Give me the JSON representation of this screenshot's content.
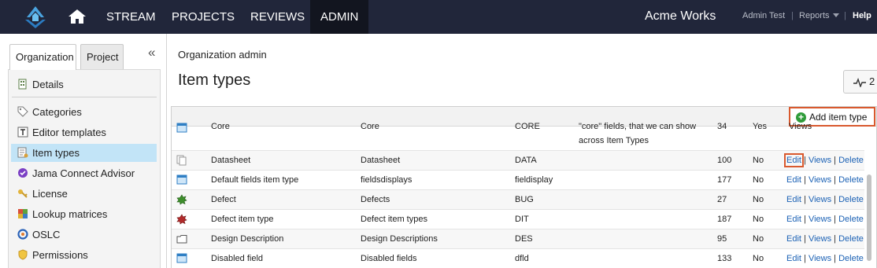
{
  "nav": {
    "items": [
      "STREAM",
      "PROJECTS",
      "REVIEWS",
      "ADMIN"
    ],
    "org_name": "Acme Works",
    "user_menu": "Admin Test",
    "reports_menu": "Reports",
    "help": "Help",
    "separator": "|"
  },
  "left_panel": {
    "tabs": [
      "Organization",
      "Project"
    ],
    "collapse_glyph": "«",
    "menu": [
      {
        "label": "Details",
        "icon": "building-icon"
      },
      {
        "label": "Categories",
        "icon": "tag-icon"
      },
      {
        "label": "Editor templates",
        "icon": "template-icon"
      },
      {
        "label": "Item types",
        "icon": "item-types-icon"
      },
      {
        "label": "Jama Connect Advisor",
        "icon": "advisor-icon"
      },
      {
        "label": "License",
        "icon": "key-icon"
      },
      {
        "label": "Lookup matrices",
        "icon": "matrix-icon"
      },
      {
        "label": "OSLC",
        "icon": "oslc-icon"
      },
      {
        "label": "Permissions",
        "icon": "shield-icon"
      }
    ]
  },
  "main": {
    "breadcrumb": "Organization admin",
    "title": "Item types",
    "stream_button": "2",
    "add_button": "Add item type",
    "links": {
      "edit": "Edit",
      "views": "Views",
      "delete": "Delete",
      "sep": "|"
    },
    "partial_row": {
      "name": "Core",
      "plural": "Core",
      "key": "CORE",
      "desc_line1": "\"core\" fields, that we can show",
      "desc_line2": "across Item Types",
      "count": "34",
      "flag": "Yes",
      "links_text": "Views"
    },
    "rows": [
      {
        "name": "Datasheet",
        "plural": "Datasheet",
        "key": "DATA",
        "count": "100",
        "flag": "No",
        "icon": "datasheet-icon"
      },
      {
        "name": "Default fields item type",
        "plural": "fieldsdisplays",
        "key": "fieldisplay",
        "count": "177",
        "flag": "No",
        "icon": "window-icon"
      },
      {
        "name": "Defect",
        "plural": "Defects",
        "key": "BUG",
        "count": "27",
        "flag": "No",
        "icon": "bug-icon"
      },
      {
        "name": "Defect item type",
        "plural": "Defect item types",
        "key": "DIT",
        "count": "187",
        "flag": "No",
        "icon": "bug-icon"
      },
      {
        "name": "Design Description",
        "plural": "Design Descriptions",
        "key": "DES",
        "count": "95",
        "flag": "No",
        "icon": "folder-icon"
      },
      {
        "name": "Disabled field",
        "plural": "Disabled fields",
        "key": "dfld",
        "count": "133",
        "flag": "No",
        "icon": "window-icon"
      }
    ]
  },
  "colors": {
    "nav_bg": "#21263a",
    "selected_menu": "#c2e4f7",
    "highlight": "#d9592e",
    "link": "#1c62b5",
    "add_green": "#2f9c3a"
  }
}
